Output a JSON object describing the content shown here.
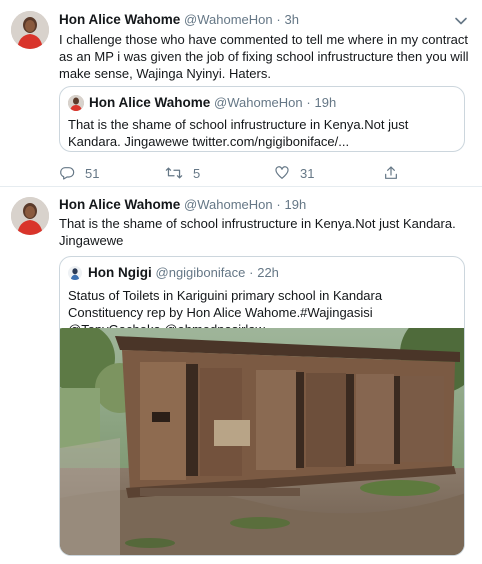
{
  "tweet1": {
    "name": "Hon Alice Wahome",
    "handle": "@WahomeHon",
    "dot": "·",
    "time": "3h",
    "text": "I challenge those who have commented to tell me where in my contract as an MP i was given the job of fixing school infrustructure then you will make sense, Wajinga Nyinyi. Haters.",
    "quote": {
      "name": "Hon Alice Wahome",
      "handle": "@WahomeHon",
      "dot": "·",
      "time": "19h",
      "text": "That is the shame of school infrustructure in Kenya.Not just Kandara. Jingawewe twitter.com/ngigiboniface/..."
    },
    "actions": {
      "replies": "51",
      "retweets": "5",
      "likes": "31"
    }
  },
  "tweet2": {
    "name": "Hon Alice Wahome",
    "handle": "@WahomeHon",
    "dot": "·",
    "time": "19h",
    "text": "That is the shame of school infrustructure in Kenya.Not just Kandara. Jingawewe",
    "quote": {
      "name": "Hon Ngigi",
      "handle": "@ngigiboniface",
      "dot": "·",
      "time": "22h",
      "text": "Status of Toilets in Kariguini primary school in Kandara Constituency rep by Hon Alice Wahome.#Wajingasisi @TonyGachoka @ahmednasirlaw"
    }
  },
  "colors": {
    "text": "#14171a",
    "secondary": "#657786",
    "border": "#ccd6dd",
    "divider": "#e6ecf0",
    "avatar_dress": "#d9342b"
  }
}
